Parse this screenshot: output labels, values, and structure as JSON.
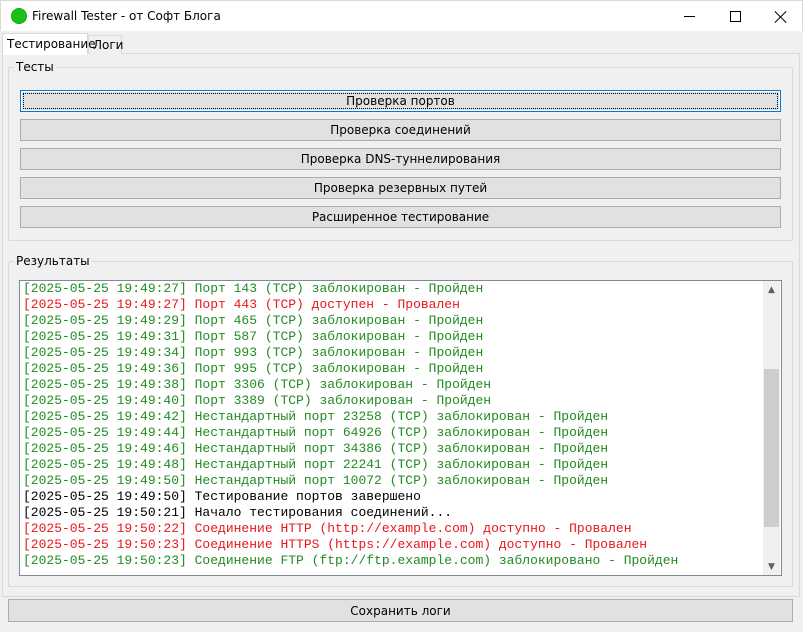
{
  "window": {
    "title": "Firewall Tester - от Софт Блога",
    "icon_color": "#19c21a"
  },
  "tabs": [
    {
      "label": "Тестирование",
      "active": true
    },
    {
      "label": "Логи",
      "active": false
    }
  ],
  "tests_group": {
    "label": "Тесты",
    "buttons": [
      {
        "label": "Проверка портов"
      },
      {
        "label": "Проверка соединений"
      },
      {
        "label": "Проверка DNS-туннелирования"
      },
      {
        "label": "Проверка резервных путей"
      },
      {
        "label": "Расширенное тестирование"
      }
    ]
  },
  "results_group": {
    "label": "Результаты",
    "colors": {
      "pass": "#228b22",
      "fail": "#e8171c",
      "info": "#000000"
    },
    "log": [
      {
        "text": "[2025-05-25 19:49:27] Порт 143 (TCP) заблокирован - Пройден",
        "status": "pass"
      },
      {
        "text": "[2025-05-25 19:49:27] Порт 443 (TCP) доступен - Провален",
        "status": "fail"
      },
      {
        "text": "[2025-05-25 19:49:29] Порт 465 (TCP) заблокирован - Пройден",
        "status": "pass"
      },
      {
        "text": "[2025-05-25 19:49:31] Порт 587 (TCP) заблокирован - Пройден",
        "status": "pass"
      },
      {
        "text": "[2025-05-25 19:49:34] Порт 993 (TCP) заблокирован - Пройден",
        "status": "pass"
      },
      {
        "text": "[2025-05-25 19:49:36] Порт 995 (TCP) заблокирован - Пройден",
        "status": "pass"
      },
      {
        "text": "[2025-05-25 19:49:38] Порт 3306 (TCP) заблокирован - Пройден",
        "status": "pass"
      },
      {
        "text": "[2025-05-25 19:49:40] Порт 3389 (TCP) заблокирован - Пройден",
        "status": "pass"
      },
      {
        "text": "[2025-05-25 19:49:42] Нестандартный порт 23258 (TCP) заблокирован - Пройден",
        "status": "pass"
      },
      {
        "text": "[2025-05-25 19:49:44] Нестандартный порт 64926 (TCP) заблокирован - Пройден",
        "status": "pass"
      },
      {
        "text": "[2025-05-25 19:49:46] Нестандартный порт 34386 (TCP) заблокирован - Пройден",
        "status": "pass"
      },
      {
        "text": "[2025-05-25 19:49:48] Нестандартный порт 22241 (TCP) заблокирован - Пройден",
        "status": "pass"
      },
      {
        "text": "[2025-05-25 19:49:50] Нестандартный порт 10072 (TCP) заблокирован - Пройден",
        "status": "pass"
      },
      {
        "text": "[2025-05-25 19:49:50] Тестирование портов завершено",
        "status": "info"
      },
      {
        "text": "[2025-05-25 19:50:21] Начало тестирования соединений...",
        "status": "info"
      },
      {
        "text": "[2025-05-25 19:50:22] Соединение HTTP (http://example.com) доступно - Провален",
        "status": "fail"
      },
      {
        "text": "[2025-05-25 19:50:23] Соединение HTTPS (https://example.com) доступно - Провален",
        "status": "fail"
      },
      {
        "text": "[2025-05-25 19:50:23] Соединение FTP (ftp://ftp.example.com) заблокировано - Пройден",
        "status": "pass"
      }
    ]
  },
  "save_button": {
    "label": "Сохранить логи"
  }
}
